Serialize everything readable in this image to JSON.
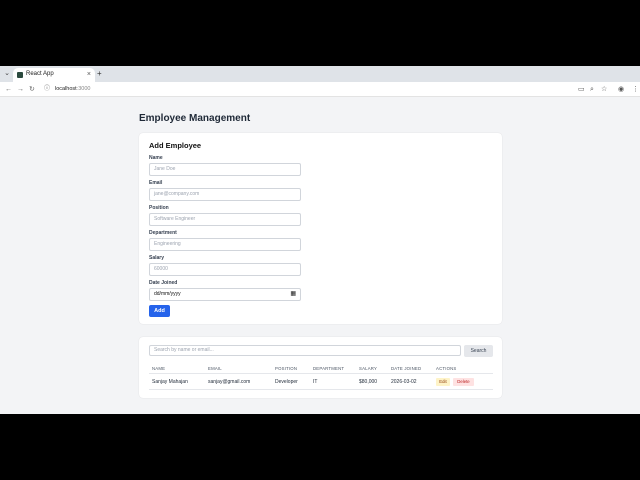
{
  "browser": {
    "tab_title": "React App",
    "tab_close": "×",
    "new_tab": "+",
    "url_host": "localhost",
    "url_port": ":3000"
  },
  "page": {
    "title": "Employee Management"
  },
  "form": {
    "heading": "Add Employee",
    "fields": [
      {
        "label": "Name",
        "placeholder": "Jane Doe"
      },
      {
        "label": "Email",
        "placeholder": "jane@company.com"
      },
      {
        "label": "Position",
        "placeholder": "Software Engineer"
      },
      {
        "label": "Department",
        "placeholder": "Engineering"
      },
      {
        "label": "Salary",
        "placeholder": "60000"
      },
      {
        "label": "Date Joined",
        "placeholder": "dd/mm/yyyy"
      }
    ],
    "submit_label": "Add"
  },
  "list": {
    "search_placeholder": "Search by name or email...",
    "search_label": "Search",
    "columns": [
      "NAME",
      "EMAIL",
      "POSITION",
      "DEPARTMENT",
      "SALARY",
      "DATE JOINED",
      "ACTIONS"
    ],
    "rows": [
      {
        "name": "Sanjay Mahajan",
        "email": "sanjay@gmail.com",
        "position": "Developer",
        "department": "IT",
        "salary": "$80,000",
        "date_joined": "2026-03-02"
      }
    ],
    "edit_label": "Edit",
    "delete_label": "Delete"
  }
}
